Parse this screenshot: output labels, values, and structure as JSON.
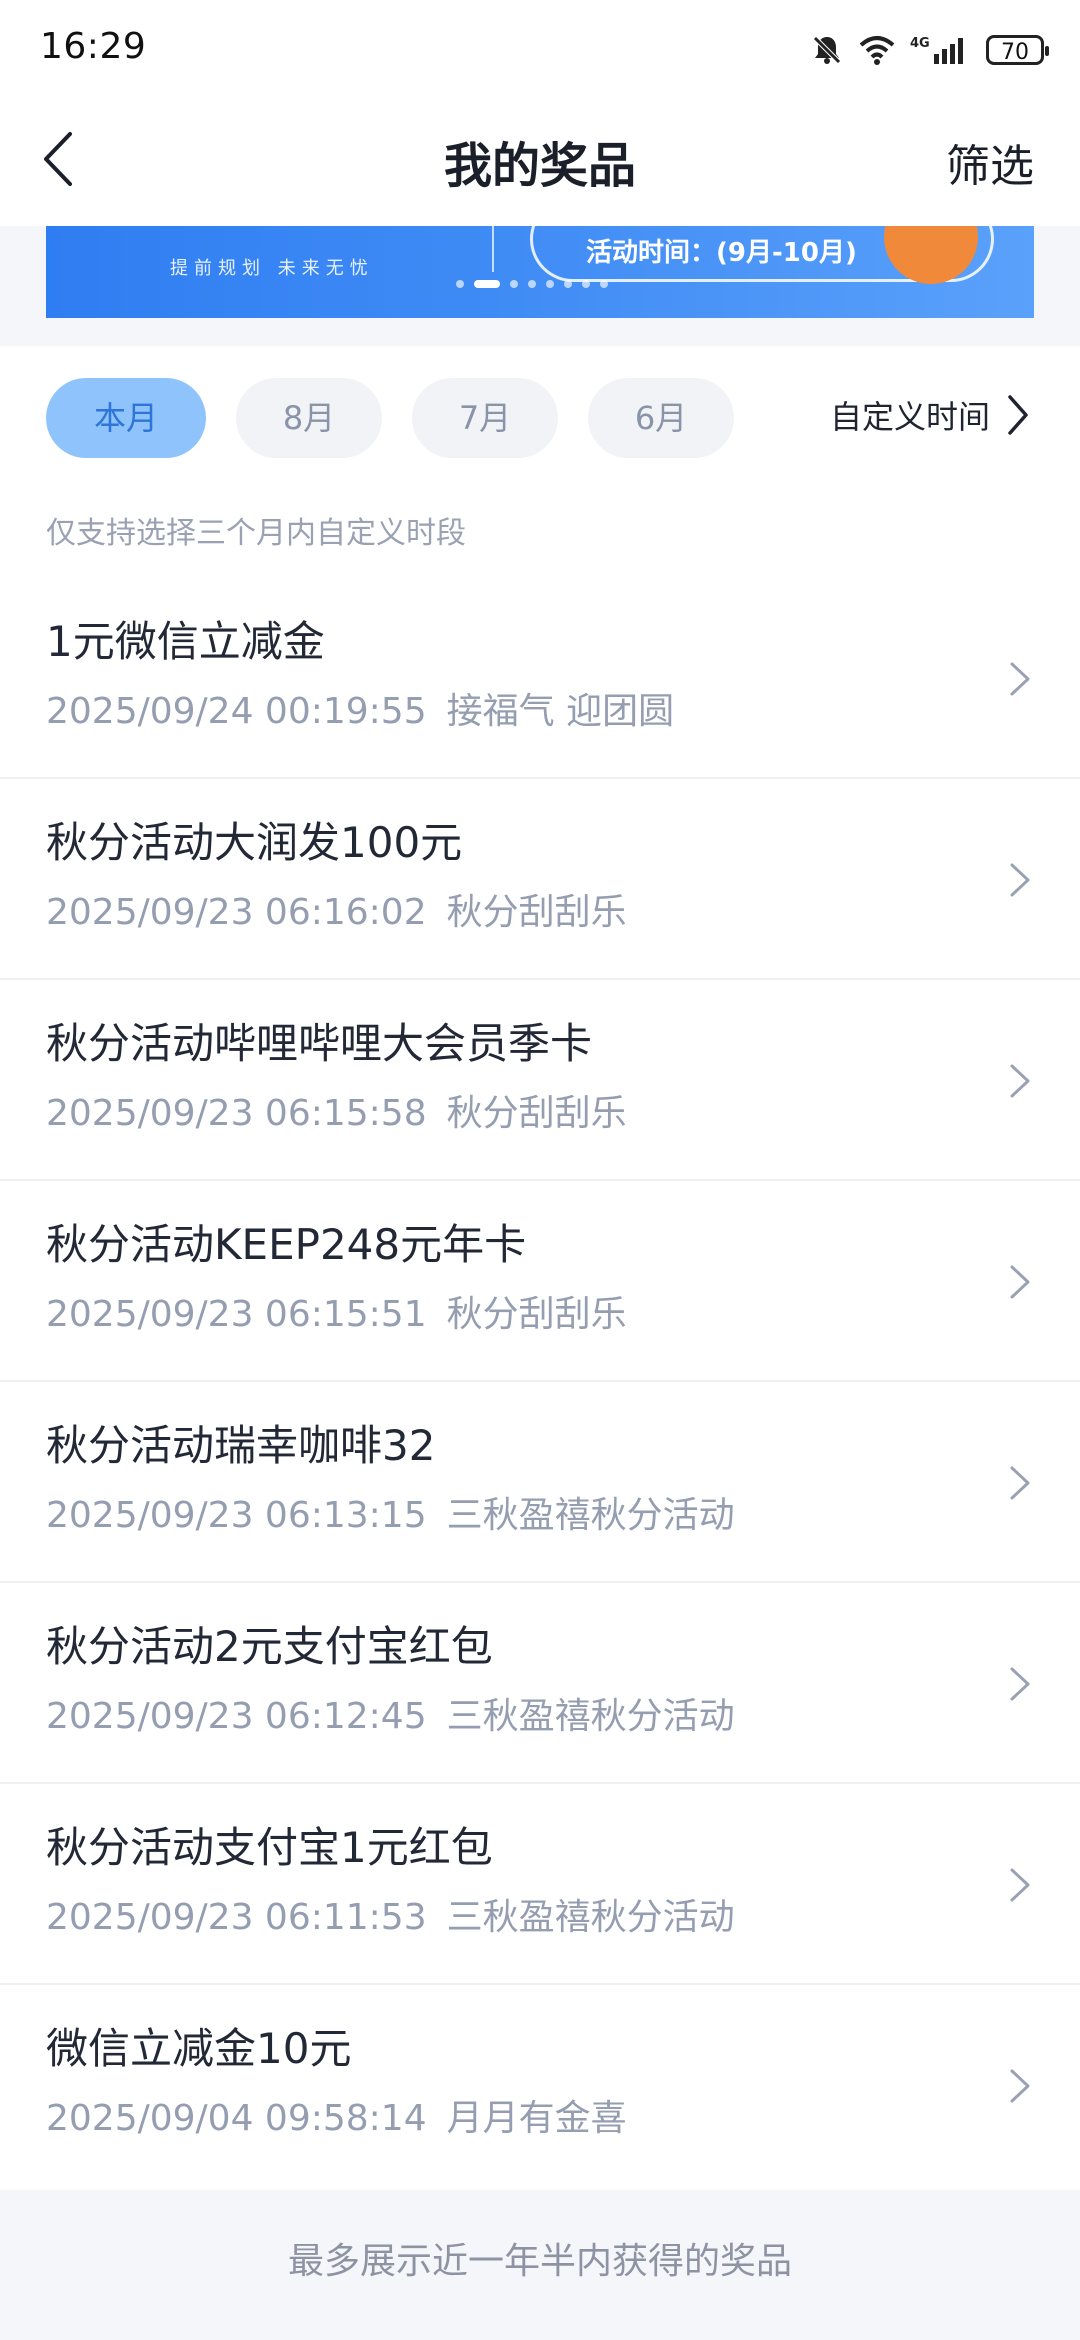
{
  "status": {
    "time": "16:29",
    "battery": "70",
    "network": "4G"
  },
  "header": {
    "title": "我的奖品",
    "filter_label": "筛选"
  },
  "banner": {
    "slogan": "提前规划  未来无忧",
    "activity_time": "活动时间：(9月-10月)"
  },
  "tabs": [
    {
      "label": "本月",
      "active": true
    },
    {
      "label": "8月",
      "active": false
    },
    {
      "label": "7月",
      "active": false
    },
    {
      "label": "6月",
      "active": false
    }
  ],
  "custom_time_label": "自定义时间",
  "hint": "仅支持选择三个月内自定义时段",
  "prizes": [
    {
      "name": "1元微信立减金",
      "time": "2025/09/24 00:19:55",
      "source": "接福气 迎团圆"
    },
    {
      "name": "秋分活动大润发100元",
      "time": "2025/09/23 06:16:02",
      "source": "秋分刮刮乐"
    },
    {
      "name": "秋分活动哔哩哔哩大会员季卡",
      "time": "2025/09/23 06:15:58",
      "source": "秋分刮刮乐"
    },
    {
      "name": "秋分活动KEEP248元年卡",
      "time": "2025/09/23 06:15:51",
      "source": "秋分刮刮乐"
    },
    {
      "name": "秋分活动瑞幸咖啡32",
      "time": "2025/09/23 06:13:15",
      "source": "三秋盈禧秋分活动"
    },
    {
      "name": "秋分活动2元支付宝红包",
      "time": "2025/09/23 06:12:45",
      "source": "三秋盈禧秋分活动"
    },
    {
      "name": "秋分活动支付宝1元红包",
      "time": "2025/09/23 06:11:53",
      "source": "三秋盈禧秋分活动"
    },
    {
      "name": "微信立减金10元",
      "time": "2025/09/04 09:58:14",
      "source": "月月有金喜"
    }
  ],
  "footer_note": "最多展示近一年半内获得的奖品",
  "colors": {
    "accent": "#2f74d8",
    "active_tab_bg": "#8ec4fb",
    "banner_blue": "#3f8bf5"
  }
}
